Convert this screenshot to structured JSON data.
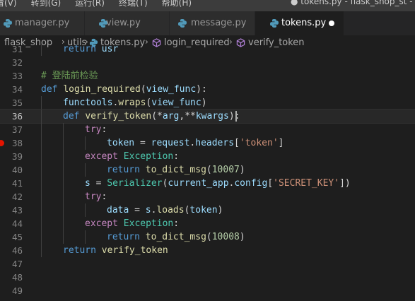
{
  "menubar": {
    "items": [
      "看(V)",
      "转到(G)",
      "运行(R)",
      "终端(T)",
      "帮助(H)"
    ],
    "window_title": "● tokens.py - flask_shop_st - Visual"
  },
  "tabs": [
    {
      "label": "manager.py",
      "icon": "python-file-icon",
      "active": false
    },
    {
      "label": "view.py",
      "icon": "python-file-icon",
      "active": false
    },
    {
      "label": "message.py",
      "icon": "python-file-icon",
      "active": false
    },
    {
      "label": "tokens.py",
      "icon": "python-file-icon",
      "active": true,
      "dirty": true
    }
  ],
  "breadcrumb": {
    "items": [
      "flask_shop",
      "utils",
      "tokens.py",
      "login_required",
      "verify_token"
    ],
    "icons": [
      "",
      "",
      "python-file-icon",
      "cube-icon",
      "cube-icon"
    ]
  },
  "editor": {
    "current_line": "36",
    "breakpoint_line": "38",
    "lines": [
      {
        "no": "31",
        "indent": 1,
        "text": "return usr"
      },
      {
        "no": "32",
        "indent": 0,
        "text": ""
      },
      {
        "no": "33",
        "indent": 0,
        "text": "# 登陆前检验"
      },
      {
        "no": "34",
        "indent": 0,
        "text": "def login_required(view_func):"
      },
      {
        "no": "35",
        "indent": 1,
        "text": "functools.wraps(view_func)"
      },
      {
        "no": "36",
        "indent": 1,
        "text": "def verify_token(*arg,**kwargs):"
      },
      {
        "no": "37",
        "indent": 2,
        "text": "try:"
      },
      {
        "no": "38",
        "indent": 3,
        "text": "token = request.headers['token']"
      },
      {
        "no": "39",
        "indent": 2,
        "text": "except Exception:"
      },
      {
        "no": "40",
        "indent": 3,
        "text": "return to_dict_msg(10007)"
      },
      {
        "no": "41",
        "indent": 2,
        "text": "s = Serializer(current_app.config['SECRET_KEY'])"
      },
      {
        "no": "42",
        "indent": 2,
        "text": "try:"
      },
      {
        "no": "43",
        "indent": 3,
        "text": "data = s.loads(token)"
      },
      {
        "no": "44",
        "indent": 2,
        "text": "except Exception:"
      },
      {
        "no": "45",
        "indent": 3,
        "text": "return to_dict_msg(10008)"
      },
      {
        "no": "46",
        "indent": 1,
        "text": "return verify_token"
      },
      {
        "no": "47",
        "indent": 0,
        "text": ""
      },
      {
        "no": "48",
        "indent": 0,
        "text": ""
      },
      {
        "no": "49",
        "indent": 0,
        "text": ""
      }
    ]
  },
  "colors": {
    "editor_bg": "#1e1e1e",
    "keyword": "#569cd6",
    "control": "#c586c0",
    "function": "#dcdcaa",
    "variable": "#9cdcfe",
    "class": "#4ec9b0",
    "string": "#ce9178",
    "number": "#b5cea8",
    "comment": "#6a9955",
    "breakpoint": "#e51400"
  }
}
